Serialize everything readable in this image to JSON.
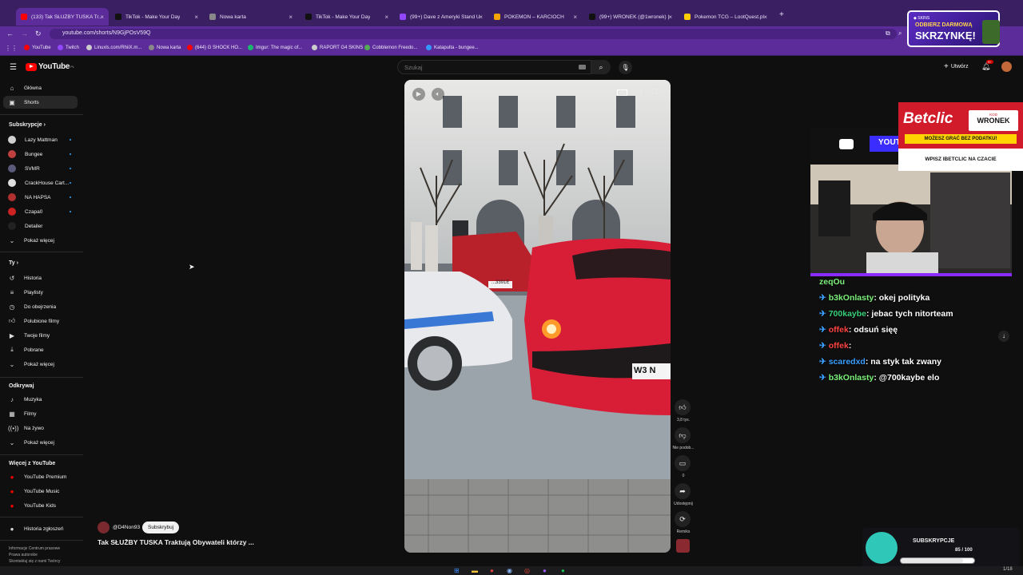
{
  "browser": {
    "tabs": [
      {
        "label": "(133) Tak SŁUŻBY TUSKA Tr...",
        "color": "#ff0000"
      },
      {
        "label": "TikTok - Make Your Day",
        "color": "#111111"
      },
      {
        "label": "Nowa karta",
        "color": "#888888"
      },
      {
        "label": "TikTok - Make Your Day",
        "color": "#111111"
      },
      {
        "label": "(99+) Dave z Ameryki Stand Up",
        "color": "#9146ff"
      },
      {
        "label": "POKEMON – KARCIOCH",
        "color": "#f4a300"
      },
      {
        "label": "(99+) WRONEK (@1wronek) | Ti...",
        "color": "#111111"
      },
      {
        "label": "Pokemon TCG – LootQuest.pl",
        "color": "#ffcc00"
      }
    ],
    "url": "youtube.com/shorts/N9GjPOsV59Q",
    "bookmarks": [
      {
        "label": "YouTube",
        "color": "#ff0000"
      },
      {
        "label": "Twitch",
        "color": "#9146ff"
      },
      {
        "label": "Linuxls.com/RhiiX.m...",
        "color": "#cccccc"
      },
      {
        "label": "Nowa karta",
        "color": "#888888"
      },
      {
        "label": "(644) G SHOCK HO...",
        "color": "#ff0000"
      },
      {
        "label": "Imgur: The magic of...",
        "color": "#1bb76e"
      },
      {
        "label": "RAPORT G4 SKINS",
        "color": "#cccccc"
      },
      {
        "label": "Cobblemon Freedo...",
        "color": "#55aa55"
      },
      {
        "label": "Katapulta - bungee...",
        "color": "#3399ff"
      }
    ]
  },
  "header": {
    "logo": "YouTube",
    "logo_region": "PL",
    "search_placeholder": "Szukaj",
    "create_label": "Utwórz",
    "notif_badge": "9+"
  },
  "sidebar": {
    "main": [
      {
        "label": "Główna",
        "icon": "home-icon"
      },
      {
        "label": "Shorts",
        "icon": "shorts-icon"
      }
    ],
    "subs_title": "Subskrypcje",
    "subs": [
      {
        "label": "Lazy Mattman",
        "color": "#d0d0d0"
      },
      {
        "label": "Bungee",
        "color": "#c04040"
      },
      {
        "label": "SVMR",
        "color": "#5a5a7a"
      },
      {
        "label": "CrackHouse Cart...",
        "color": "#e0e0e0"
      },
      {
        "label": "NA HAPSA",
        "color": "#b03030"
      },
      {
        "label": "Czapa0",
        "color": "#cc2222"
      },
      {
        "label": "Detailer",
        "color": "#222222"
      }
    ],
    "subs_more": "Pokaż więcej",
    "you_title": "Ty",
    "you": [
      {
        "label": "Historia",
        "icon": "history-icon"
      },
      {
        "label": "Playlisty",
        "icon": "playlist-icon"
      },
      {
        "label": "Do obejrzenia",
        "icon": "watch-later-icon"
      },
      {
        "label": "Polubione filmy",
        "icon": "like-icon"
      },
      {
        "label": "Twoje filmy",
        "icon": "your-videos-icon"
      },
      {
        "label": "Pobrane",
        "icon": "download-icon"
      },
      {
        "label": "Pokaż więcej",
        "icon": "chevron-down-icon"
      }
    ],
    "explore_title": "Odkrywaj",
    "explore": [
      {
        "label": "Muzyka",
        "icon": "music-icon"
      },
      {
        "label": "Filmy",
        "icon": "film-icon"
      },
      {
        "label": "Na żywo",
        "icon": "live-icon"
      },
      {
        "label": "Pokaż więcej",
        "icon": "chevron-down-icon"
      }
    ],
    "more_title": "Więcej z YouTube",
    "more": [
      {
        "label": "YouTube Premium"
      },
      {
        "label": "YouTube Music"
      },
      {
        "label": "YouTube Kids"
      }
    ],
    "report": "Historia zgłoszeń",
    "footer1": "Informacje   Centrum prasowe",
    "footer2": "Prawa autorskie",
    "footer3": "Skontaktuj się z nami   Twórcy"
  },
  "short": {
    "channel": "@D4Non93",
    "subscribe": "Subskrybuj",
    "title": "Tak SŁUŻBY TUSKA Traktują Obywateli którzy ...",
    "likes": "3,8 tys.",
    "dislike": "Nie podob...",
    "comments": "0",
    "share": "Udostępnij",
    "remix": "Remiks",
    "plate_left": "...3391E",
    "plate_right": "W3 N"
  },
  "stream": {
    "ad_brand": "Betclic",
    "ad_code_label": "KOD",
    "ad_code": "WRONEK",
    "ad_tagline": "MOŻESZ GRAĆ BEZ PODATKU!",
    "ad_cta": "WPISZ IBETCLIC NA CZACIE",
    "promo_line1": "ODBIERZ DARMOWĄ",
    "promo_line2": "SKRZYNKĘ!",
    "yt_label": "YOUT",
    "chat": [
      {
        "user": "zeqOu",
        "msg": "",
        "color": "#7cf27a"
      },
      {
        "user": "b3kOnlasty",
        "msg": ": okej polityka",
        "color": "#7cf27a"
      },
      {
        "user": "700kaybe",
        "msg": ": jebac tych nitorteam",
        "color": "#3ad17a"
      },
      {
        "user": "offek",
        "msg": ": odsuń sięę",
        "color": "#ff4444"
      },
      {
        "user": "offek",
        "msg": ":",
        "color": "#ff4444"
      },
      {
        "user": "scaredxd",
        "msg": ": na styk tak zwany",
        "color": "#3aa0ff"
      },
      {
        "user": "b3kOnlasty",
        "msg": ": @700kaybe elo",
        "color": "#7cf27a"
      }
    ],
    "subs_label": "SUBSKRYPCJE",
    "subs_count": "85 / 100",
    "subs_progress": 0.85
  },
  "taskbar": {
    "time": "1/18"
  }
}
